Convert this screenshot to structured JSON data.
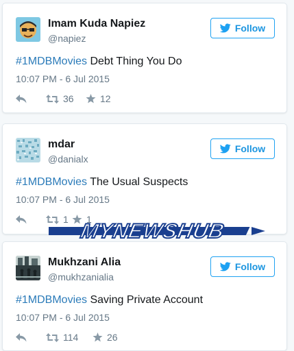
{
  "follow_label": "Follow",
  "colors": {
    "link": "#2b7bb9",
    "button": "#1b95e0",
    "muted": "#657786"
  },
  "watermark": "MYNEWSHUB",
  "tweets": [
    {
      "name": "Imam Kuda Napiez",
      "handle": "@napiez",
      "hashtag": "#1MDBMovies",
      "text": " Debt Thing You Do",
      "time": "10:07 PM - 6 Jul 2015",
      "retweets": "36",
      "likes": "12"
    },
    {
      "name": "mdar",
      "handle": "@danialx",
      "hashtag": "#1MDBMovies",
      "text": " The Usual Suspects",
      "time": "10:07 PM - 6 Jul 2015",
      "retweets": "1",
      "likes": "1"
    },
    {
      "name": "Mukhzani Alia",
      "handle": "@mukhzanialia",
      "hashtag": "#1MDBMovies",
      "text": " Saving Private Account",
      "time": "10:07 PM - 6 Jul 2015",
      "retweets": "114",
      "likes": "26"
    }
  ]
}
